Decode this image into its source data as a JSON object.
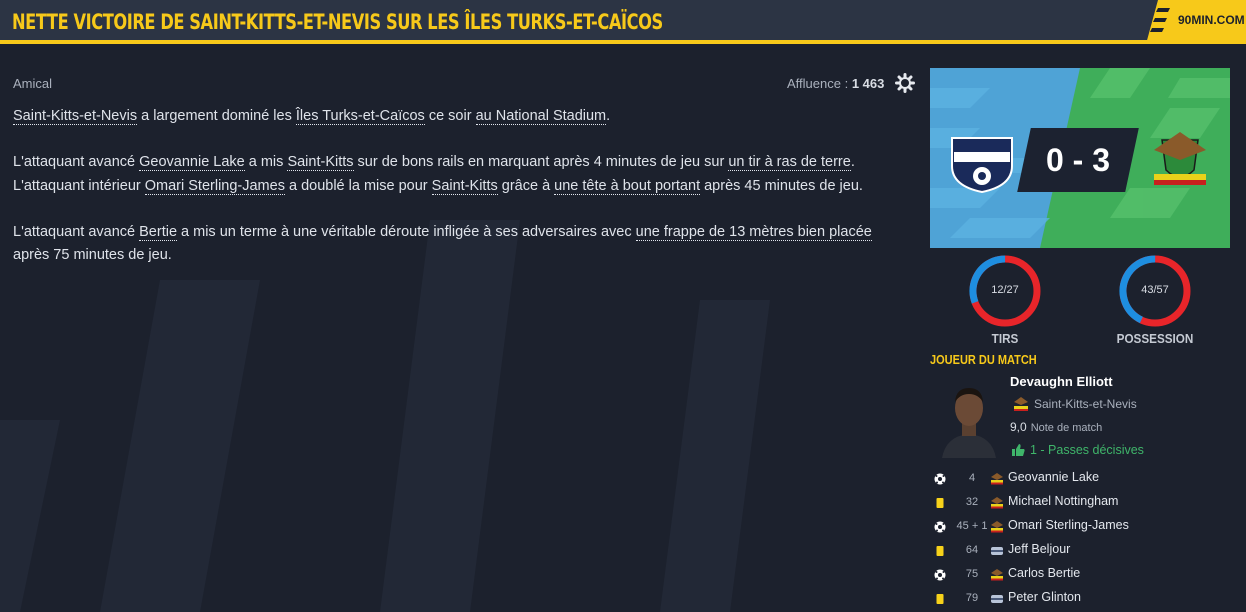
{
  "header": {
    "title": "NETTE VICTOIRE DE SAINT-KITTS-ET-NEVIS SUR LES ÎLES TURKS-ET-CAÏCOS",
    "logo": "90MIN.COM"
  },
  "article": {
    "category": "Amical",
    "attendance_label": "Affluence : ",
    "attendance_value": "1 463",
    "p1": {
      "t1": "Saint-Kitts-et-Nevis",
      "t2": " a largement dominé les ",
      "t3": "Îles Turks-et-Caïcos",
      "t4": " ce soir ",
      "t5": "au National Stadium",
      "t6": "."
    },
    "p2": {
      "t1": "L'attaquant avancé ",
      "t2": "Geovannie Lake",
      "t3": " a mis ",
      "t4": "Saint-Kitts",
      "t5": " sur de bons rails en marquant après 4 minutes de jeu sur ",
      "t6": "un tir à ras de terre",
      "t7": "."
    },
    "p3": {
      "t1": "L'attaquant intérieur ",
      "t2": "Omari Sterling-James",
      "t3": " a doublé la mise pour ",
      "t4": "Saint-Kitts",
      "t5": " grâce à ",
      "t6": "une tête à bout portant",
      "t7": " après 45 minutes de jeu."
    },
    "p4": {
      "t1": "L'attaquant avancé ",
      "t2": "Bertie",
      "t3": " a mis un terme à une véritable déroute infligée à ses adversaires avec ",
      "t4": "une frappe de 13 mètres bien placée"
    },
    "p5": "après 75 minutes de jeu."
  },
  "score": {
    "text": "0 - 3",
    "home": 0,
    "away": 3
  },
  "stats": {
    "shots": {
      "label": "TIRS",
      "value": "12/27",
      "home": 12,
      "away": 27
    },
    "possession": {
      "label": "POSSESSION",
      "value": "43/57",
      "home": 43,
      "away": 57
    }
  },
  "motm": {
    "title": "JOUEUR DU MATCH",
    "name": "Devaughn Elliott",
    "team": "Saint-Kitts-et-Nevis",
    "rating": "9,0",
    "rating_label": "Note de match",
    "assists": "1 - Passes décisives"
  },
  "events": [
    {
      "type": "goal",
      "minute": "4",
      "team": "skn",
      "player": "Geovannie Lake"
    },
    {
      "type": "yellow",
      "minute": "32",
      "team": "skn",
      "player": "Michael Nottingham"
    },
    {
      "type": "goal",
      "minute": "45 + 1",
      "team": "skn",
      "player": "Omari Sterling-James"
    },
    {
      "type": "yellow",
      "minute": "64",
      "team": "tci",
      "player": "Jeff Beljour"
    },
    {
      "type": "goal",
      "minute": "75",
      "team": "skn",
      "player": "Carlos Bertie"
    },
    {
      "type": "yellow",
      "minute": "79",
      "team": "tci",
      "player": "Peter Glinton"
    }
  ],
  "colors": {
    "accent": "#f7c91a",
    "home": "#1e8ee0",
    "away": "#e8252a",
    "assist": "#3fb56a"
  }
}
